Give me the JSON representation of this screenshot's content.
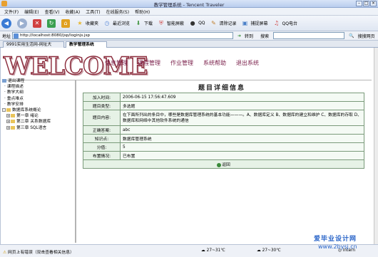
{
  "window": {
    "title": "教学管理系统 - Tencent Traveler"
  },
  "menu": [
    "文件(F)",
    "编辑(E)",
    "查看(V)",
    "收藏(A)",
    "工具(T)",
    "在线服务(S)",
    "帮助(H)"
  ],
  "toolbar": [
    {
      "label": "",
      "icon": "back-icon",
      "color": "#3a7bd5"
    },
    {
      "label": "",
      "icon": "forward-icon",
      "color": "#9bb0d0"
    },
    {
      "label": "",
      "icon": "stop-icon",
      "color": "#d04040"
    },
    {
      "label": "",
      "icon": "refresh-icon",
      "color": "#3aa050"
    },
    {
      "label": "",
      "icon": "home-icon",
      "color": "#e0a020"
    },
    {
      "label": "收藏夹",
      "icon": "favorites-icon",
      "color": "#e8b830"
    },
    {
      "label": "最近浏览",
      "icon": "history-icon",
      "color": "#5a8ad8"
    },
    {
      "label": "下载",
      "icon": "download-icon",
      "color": "#4a9a4a"
    },
    {
      "label": "智能屏蔽",
      "icon": "shield-icon",
      "color": "#d05050"
    },
    {
      "label": "QQ",
      "icon": "qq-icon",
      "color": "#333333"
    },
    {
      "label": "清除记录",
      "icon": "clear-icon",
      "color": "#c08030"
    },
    {
      "label": "捕捉屏幕",
      "icon": "capture-icon",
      "color": "#4a80c8"
    },
    {
      "label": "QQ电台",
      "icon": "radio-icon",
      "color": "#d04848"
    }
  ],
  "address": {
    "label": "地址",
    "url": "http://localhost:8080/jsp/loginjs.jsp",
    "go_label": "转到",
    "search_label": "搜索",
    "search_web_label": "搜搜网页"
  },
  "tabs": [
    {
      "label": "9991实用生活网-网址大",
      "active": false
    },
    {
      "label": "教学管理系统",
      "active": true
    }
  ],
  "page": {
    "logo": "WELCOME",
    "nav": [
      "信息管理",
      "课程管理",
      "作业管理",
      "系统帮助",
      "退出系统"
    ],
    "tree": [
      {
        "label": "退出课程",
        "level": 0,
        "type": "link"
      },
      {
        "label": "课程描述",
        "level": 0,
        "type": "link"
      },
      {
        "label": "教学大纲",
        "level": 0,
        "type": "link"
      },
      {
        "label": "重点难点",
        "level": 0,
        "type": "link"
      },
      {
        "label": "教学安排",
        "level": 0,
        "type": "link"
      },
      {
        "label": "数据库系统概论",
        "level": 0,
        "type": "folder",
        "toggle": "-"
      },
      {
        "label": "第一章  绪论",
        "level": 1,
        "type": "folder",
        "toggle": "+"
      },
      {
        "label": "第二章  关系数据库",
        "level": 1,
        "type": "folder",
        "toggle": "+"
      },
      {
        "label": "第三章  SQL语言",
        "level": 1,
        "type": "folder",
        "toggle": "+"
      }
    ],
    "heading": "题目详细信息",
    "details": [
      {
        "key": "加入时间:",
        "value": "2006-06-15 17:56:47.609"
      },
      {
        "key": "题目类型:",
        "value": "多选题"
      },
      {
        "key": "题目内容:",
        "value": "在下面所列出的条目中，哪些是数据库管理系统的基本功能———。A、数据库定义 B、数据库的建立和维护 C、数据库的存取 D、数据库和网络中其他软件系统的通信"
      },
      {
        "key": "正确答案:",
        "value": "abc"
      },
      {
        "key": "知识点:",
        "value": "数据库管理系统"
      },
      {
        "key": "分值:",
        "value": "5"
      },
      {
        "key": "布置情况:",
        "value": "已布置"
      }
    ],
    "back_label": "返回"
  },
  "status": {
    "left": "网页上有错误（双击查看相关信息）",
    "weather1": "27~31℃",
    "weather2": "27~30℃",
    "net": "Intern"
  },
  "watermark": {
    "line1": "爱毕业设计网",
    "line2": "www.2bysj.cn"
  }
}
